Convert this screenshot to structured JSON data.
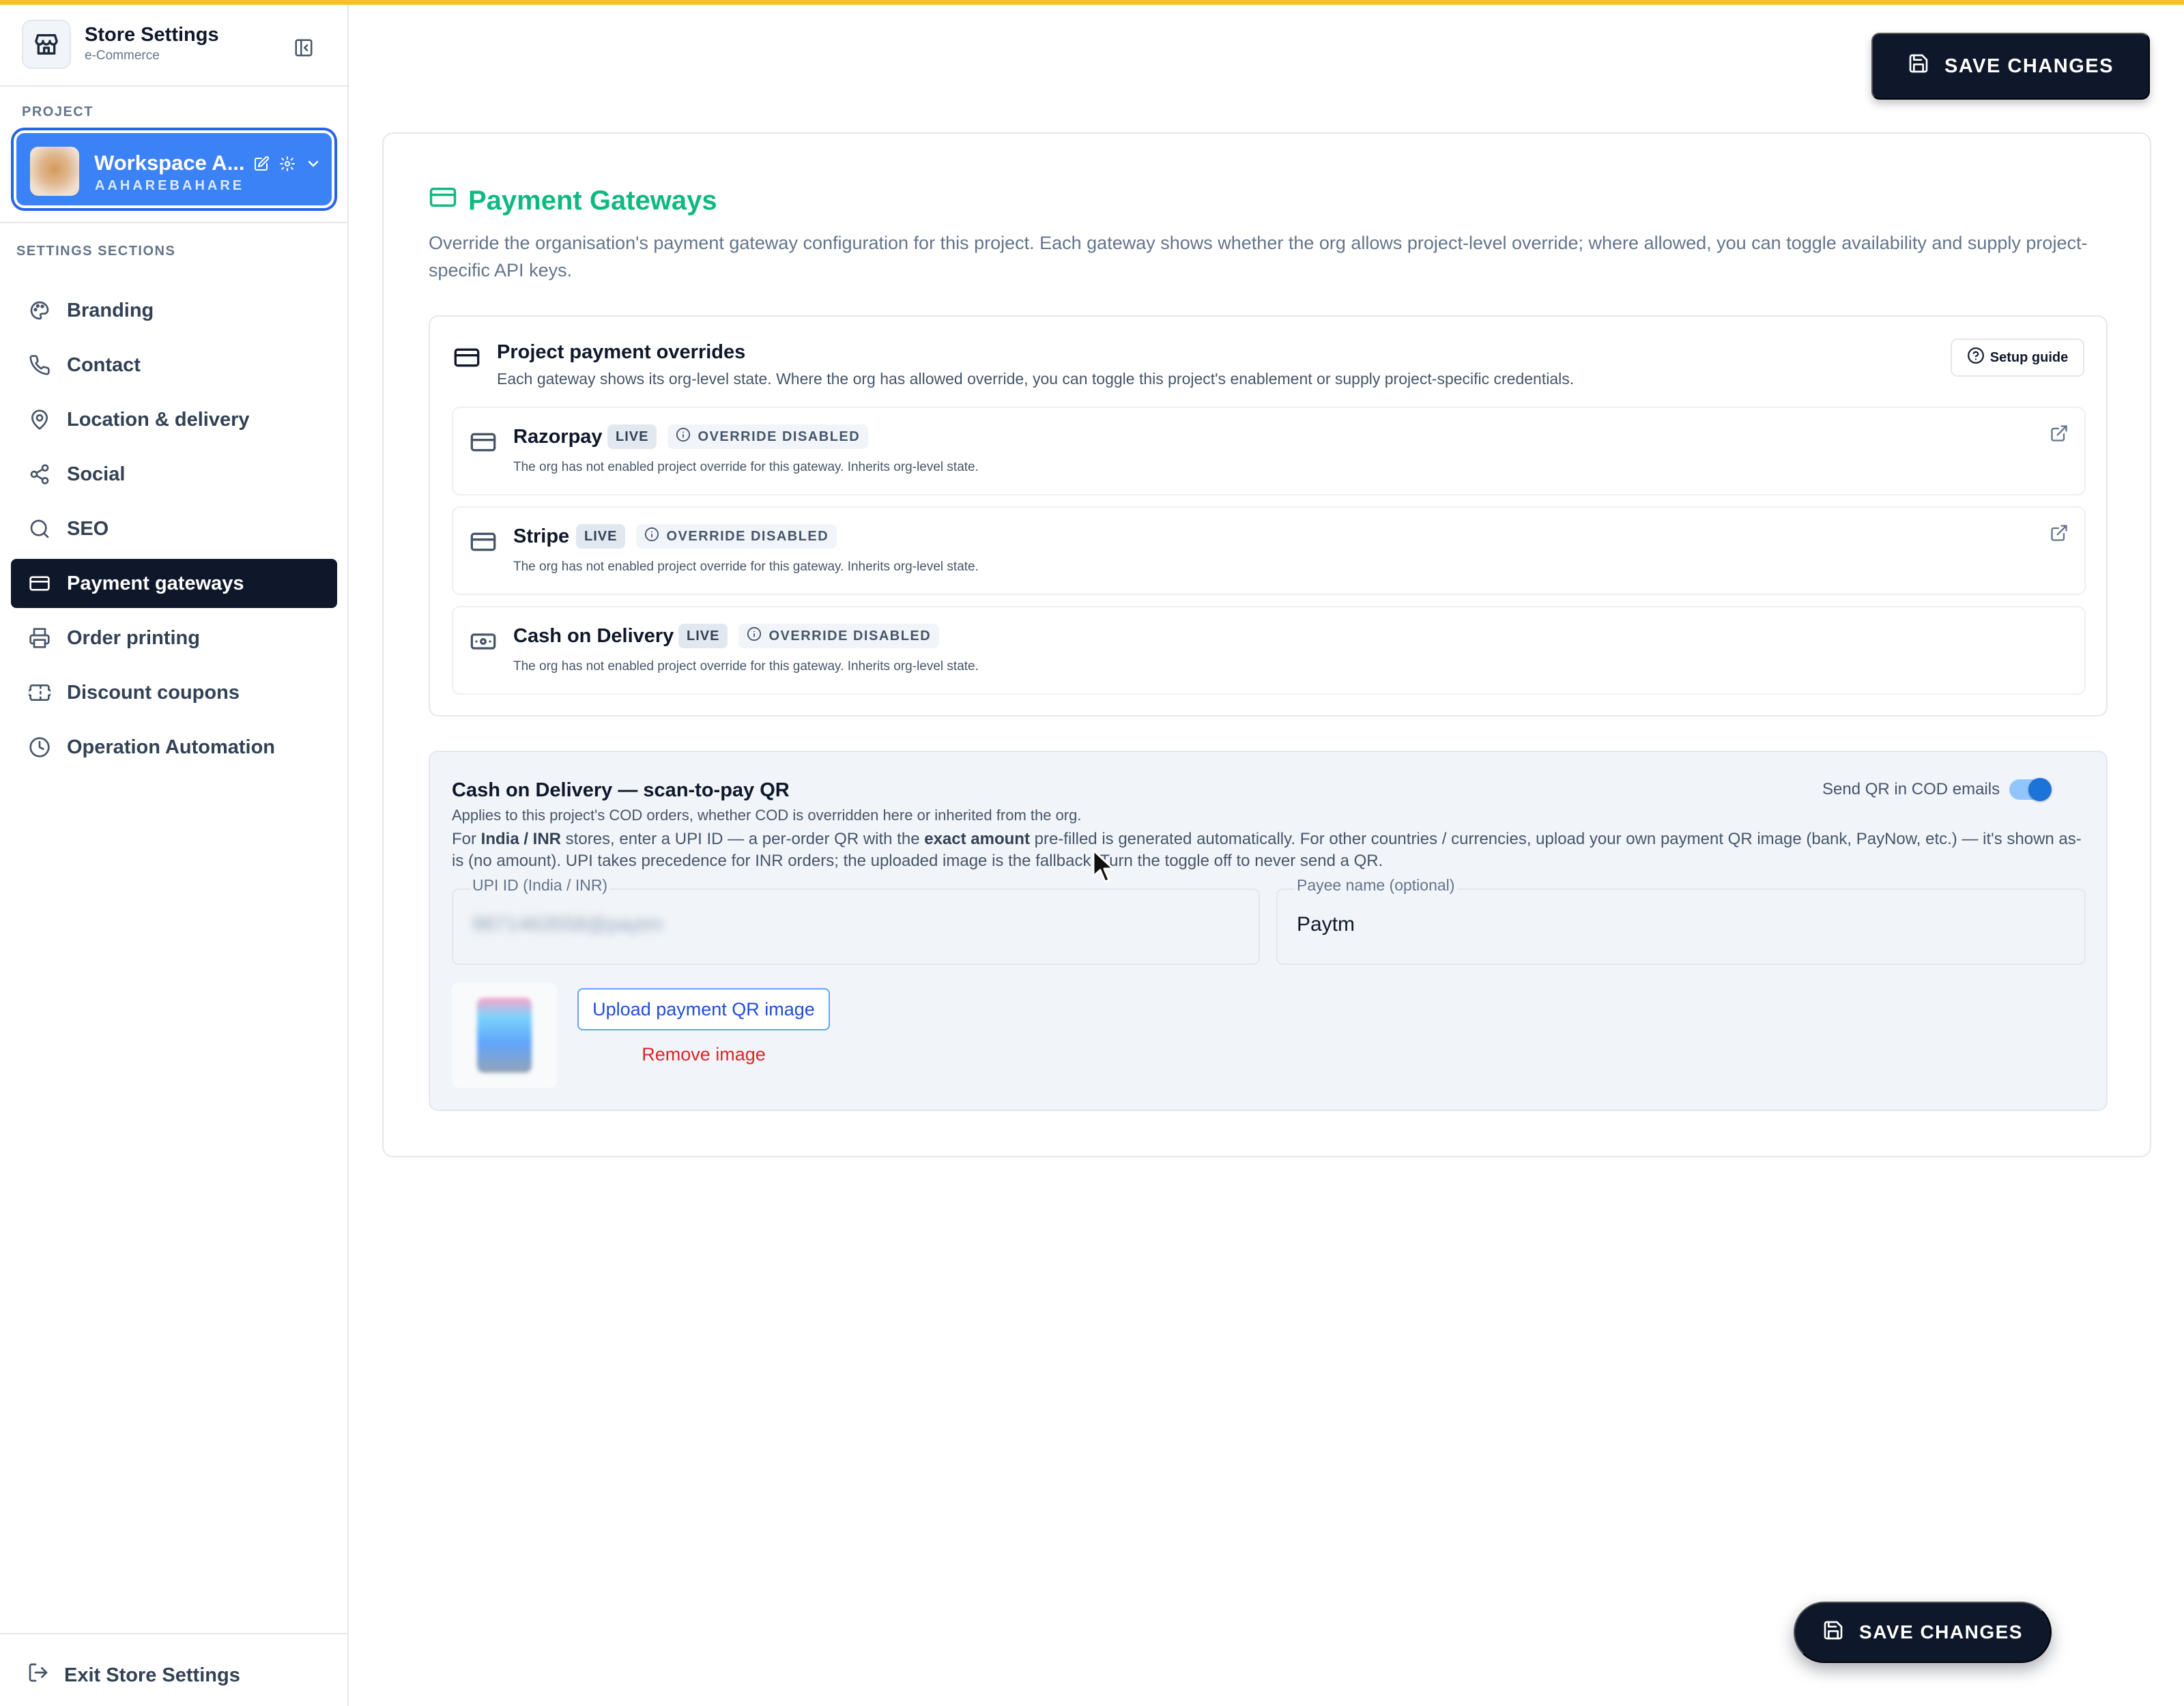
{
  "sidebar": {
    "store_title": "Store Settings",
    "store_subtitle": "e-Commerce",
    "project_section_label": "PROJECT",
    "project": {
      "name": "Workspace A...",
      "slug": "AAHAREBAHARE"
    },
    "settings_section_label": "SETTINGS SECTIONS",
    "items": [
      {
        "label": "Branding",
        "icon": "palette-icon"
      },
      {
        "label": "Contact",
        "icon": "phone-icon"
      },
      {
        "label": "Location & delivery",
        "icon": "map-pin-icon"
      },
      {
        "label": "Social",
        "icon": "share-icon"
      },
      {
        "label": "SEO",
        "icon": "search-icon"
      },
      {
        "label": "Payment gateways",
        "icon": "credit-card-icon",
        "active": true
      },
      {
        "label": "Order printing",
        "icon": "printer-icon"
      },
      {
        "label": "Discount coupons",
        "icon": "ticket-icon"
      },
      {
        "label": "Operation Automation",
        "icon": "clock-icon"
      }
    ],
    "exit_label": "Exit Store Settings"
  },
  "toolbar": {
    "save_label": "SAVE CHANGES"
  },
  "floating": {
    "save_label": "SAVE CHANGES"
  },
  "main": {
    "title": "Payment Gateways",
    "description": "Override the organisation's payment gateway configuration for this project. Each gateway shows whether the org allows project-level override; where allowed, you can toggle availability and supply project-specific API keys.",
    "overrides": {
      "title": "Project payment overrides",
      "subtitle": "Each gateway shows its org-level state. Where the org has allowed override, you can toggle this project's enablement or supply project-specific credentials.",
      "setup_guide_label": "Setup guide",
      "gateways": [
        {
          "name": "Razorpay",
          "live": "LIVE",
          "override": "OVERRIDE DISABLED",
          "desc": "The org has not enabled project override for this gateway. Inherits org-level state.",
          "icon": "credit-card-icon",
          "has_link": true
        },
        {
          "name": "Stripe",
          "live": "LIVE",
          "override": "OVERRIDE DISABLED",
          "desc": "The org has not enabled project override for this gateway. Inherits org-level state.",
          "icon": "credit-card-icon",
          "has_link": true
        },
        {
          "name": "Cash on Delivery",
          "live": "LIVE",
          "override": "OVERRIDE DISABLED",
          "desc": "The org has not enabled project override for this gateway. Inherits org-level state.",
          "icon": "banknote-icon",
          "has_link": false
        }
      ]
    },
    "cod_qr": {
      "title": "Cash on Delivery — scan-to-pay QR",
      "subtitle": "Applies to this project's COD orders, whether COD is overridden here or inherited from the org.",
      "body_parts": {
        "p1": "For ",
        "b1": "India / INR",
        "p2": " stores, enter a UPI ID — a per-order QR with the ",
        "b2": "exact amount",
        "p3": " pre-filled is generated automatically. For other countries / currencies, upload your own payment QR image (bank, PayNow, etc.) — it's shown as-is (no amount). UPI takes precedence for INR orders; the uploaded image is the fallback. Turn the toggle off to never send a QR."
      },
      "toggle_label": "Send QR in COD emails",
      "toggle_on": true,
      "upi_label": "UPI ID (India / INR)",
      "upi_value": "9871463558@paytm",
      "payee_label": "Payee name (optional)",
      "payee_value": "Paytm",
      "upload_label": "Upload payment QR image",
      "remove_label": "Remove image"
    }
  },
  "colors": {
    "accent": "#10b981",
    "dark": "#0f172a",
    "project": "#3b82f6",
    "topbar": "#f5c02d",
    "danger": "#dc2626"
  }
}
